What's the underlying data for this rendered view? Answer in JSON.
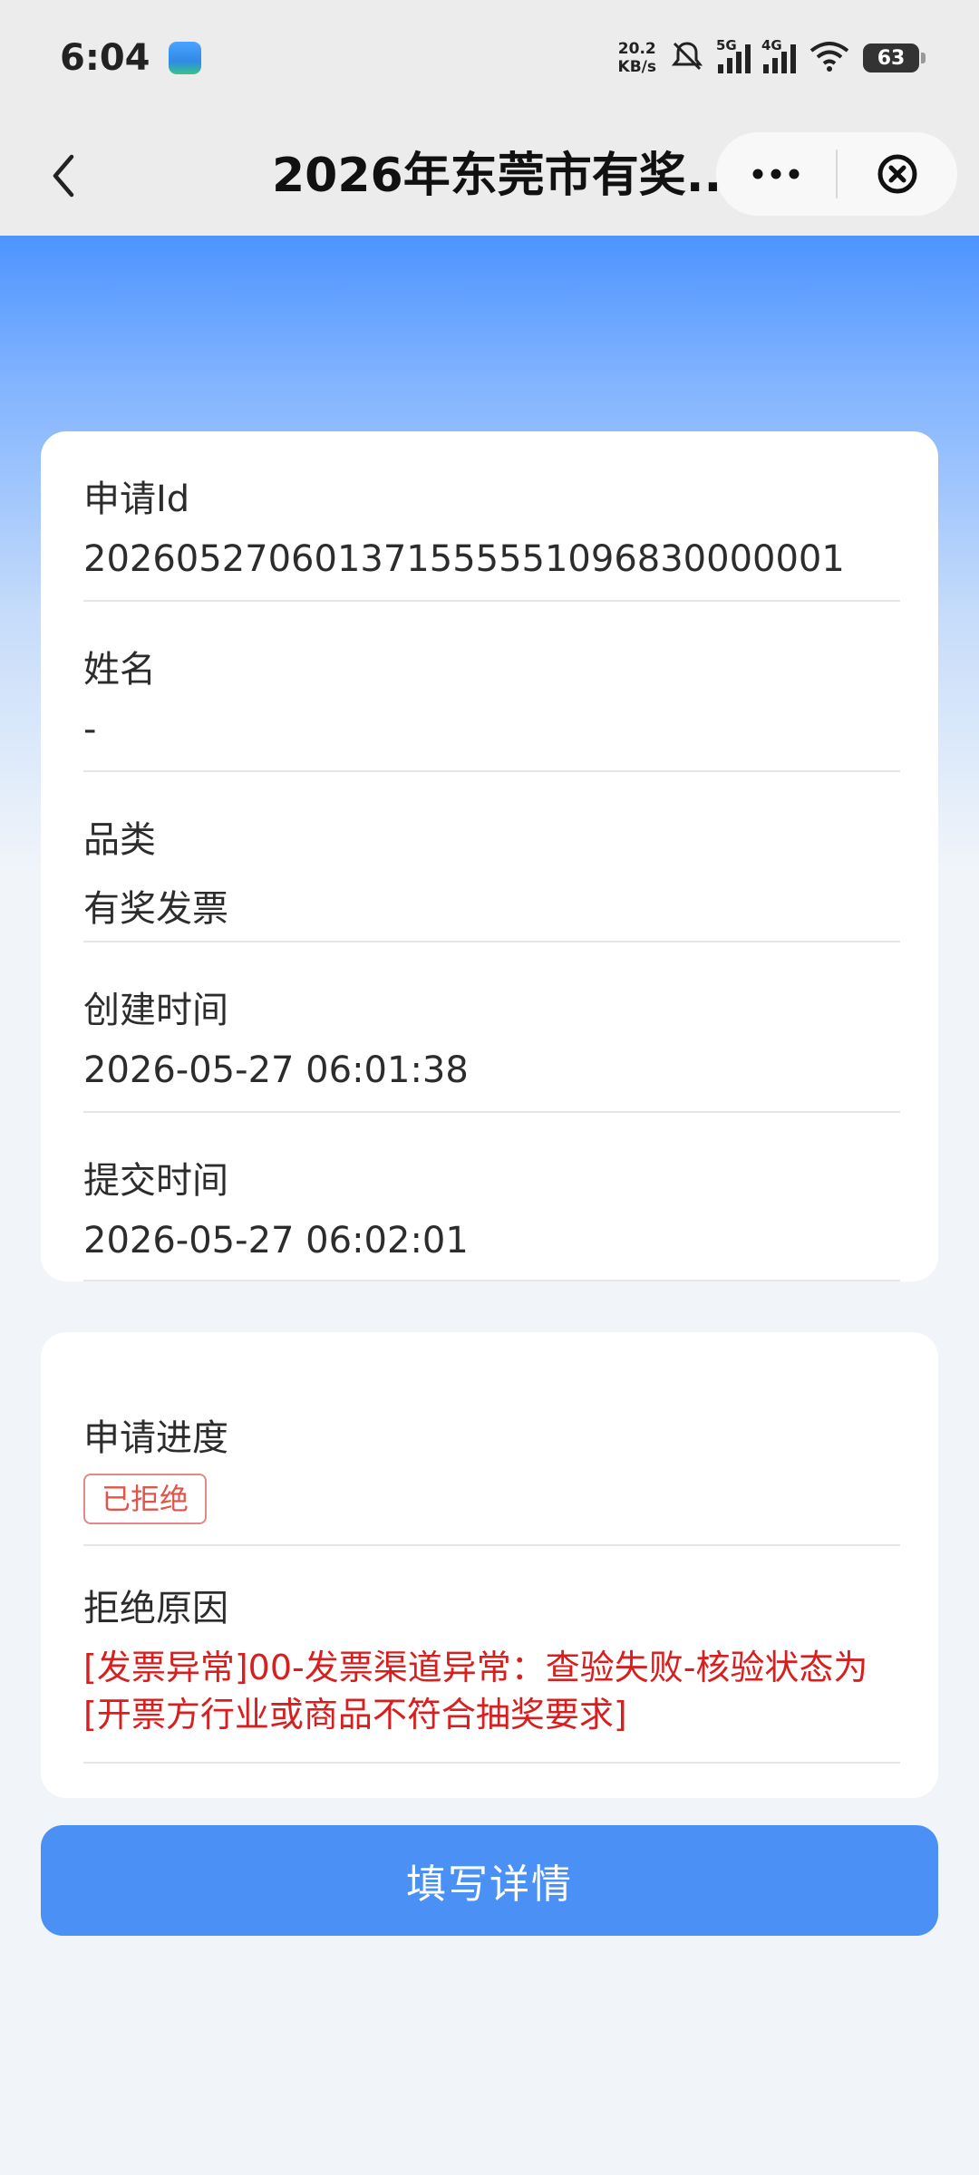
{
  "status_bar": {
    "time": "6:04",
    "net_speed_value": "20.2",
    "net_speed_unit": "KB/s",
    "sim1_type": "5G",
    "sim2_type": "4G",
    "battery_level": "63"
  },
  "nav": {
    "title": "2026年东莞市有奖...",
    "back_icon": "chevron-left-icon",
    "more_icon": "more-dots-icon",
    "close_icon": "close-circle-icon"
  },
  "info_card": {
    "fields": [
      {
        "label": "申请Id",
        "value": "202605270601371555551096830000001"
      },
      {
        "label": "姓名",
        "value": "-"
      },
      {
        "label": "品类",
        "value": "有奖发票"
      },
      {
        "label": "创建时间",
        "value": "2026-05-27 06:01:38"
      },
      {
        "label": "提交时间",
        "value": "2026-05-27 06:02:01"
      }
    ]
  },
  "progress_card": {
    "progress_label": "申请进度",
    "status": "已拒绝",
    "reason_label": "拒绝原因",
    "reason_text": "[发票异常]00-发票渠道异常：查验失败-核验状态为[开票方行业或商品不符合抽奖要求]"
  },
  "action": {
    "fill_details_label": "填写详情"
  },
  "colors": {
    "accent": "#4a90f5",
    "danger": "#d81e1e",
    "badge_border": "#e08a85"
  }
}
